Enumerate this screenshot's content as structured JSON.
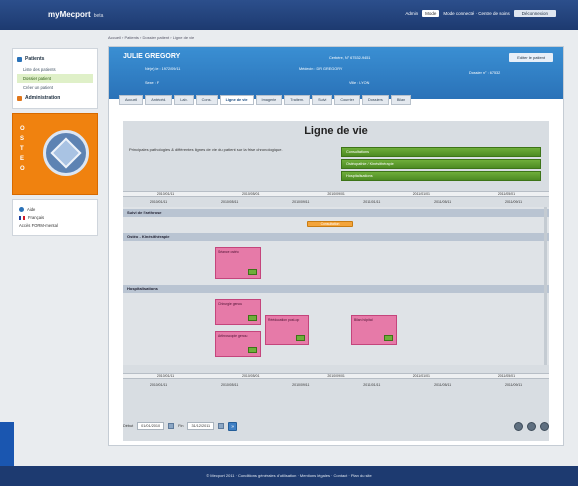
{
  "app": {
    "logo": "myMecport",
    "logo_sub": "beta"
  },
  "topbar": {
    "user_label": "Admin",
    "select_value": "Mode",
    "status_text": "Mode connecté · Centre de soins",
    "button_label": "Déconnexion"
  },
  "breadcrumb": "Accueil › Patients › Dossier patient › Ligne de vie",
  "sidebar": {
    "sections": [
      {
        "label": "Patients",
        "icon": "patients-icon",
        "color": "#2a72b8",
        "items": [
          {
            "label": "Liste des patients",
            "active": false
          },
          {
            "label": "Dossier patient",
            "active": true
          },
          {
            "label": "Créer un patient",
            "active": false
          }
        ]
      },
      {
        "label": "Administration",
        "icon": "admin-icon",
        "color": "#e0761a",
        "items": []
      }
    ],
    "promo_letters": [
      "O",
      "S",
      "T",
      "E",
      "O"
    ],
    "help": {
      "label": "Aide",
      "icon": "help-icon"
    },
    "lang": {
      "label": "Français",
      "link": "Accès FORM-mental"
    }
  },
  "patient": {
    "name": "JULIE GREGORY",
    "fields": [
      {
        "k": "Né(e) le : 1972/09/11",
        "pos": "top"
      },
      {
        "k": "Médecin : DR GREGORY",
        "pos": "mid"
      },
      {
        "k": "Sexe : F",
        "pos": "low"
      },
      {
        "k": "Dossier n° : 67532",
        "pos": "right"
      },
      {
        "k": "Ville : LYON",
        "pos": "low2"
      }
    ],
    "button": "Editer le patient",
    "right_info": "Cerbère, N° 67532-9451"
  },
  "tabs": [
    "Accueil",
    "Antécéd.",
    "Lab.",
    "Cons.",
    "Ligne de vie",
    "Imagerie",
    "Traitem.",
    "Suivi",
    "Courrier",
    "Dossiers",
    "Bilan"
  ],
  "active_tab": 4,
  "lifeline": {
    "title": "Ligne de vie",
    "intro": "Principales pathologies & différentes lignes de vie du patient sur la frise chronologique.",
    "legend": [
      "Consultations",
      "Ostéopathie / Kinésithérapie",
      "Hospitalisations"
    ],
    "axis_top": [
      "2010/01/11",
      "2010/05/01",
      "2010/09/01",
      "2011/01/01",
      "2011/05/01"
    ],
    "axis_sub": [
      "2010/01/11",
      "2010/05/11",
      "2010/09/11",
      "2011/01/11",
      "2011/05/11",
      "2011/09/11"
    ],
    "lanes": [
      {
        "label": "Suivi de l'arthrose",
        "bar_label": "Consultation"
      },
      {
        "label": "Ostéo - Kinésithérapie"
      },
      {
        "label": "Hospitalisations"
      }
    ],
    "cards": [
      {
        "label": "Séance ostéo",
        "lane": 1
      },
      {
        "label": "Chirurgie genou",
        "lane": 2
      },
      {
        "label": "Arthroscopie genou",
        "lane": 2
      },
      {
        "label": "Rééducation post-op",
        "lane": 2
      },
      {
        "label": "Bilan hôpital",
        "lane": 2
      }
    ]
  },
  "toolbar": {
    "from_label": "Début",
    "from_value": "01/01/2010",
    "to_label": "Fin",
    "to_value": "31/12/2011",
    "go": "»"
  },
  "footer": "© Mecport 2011 · Conditions générales d'utilisation · Mentions légales · Contact · Plan du site"
}
